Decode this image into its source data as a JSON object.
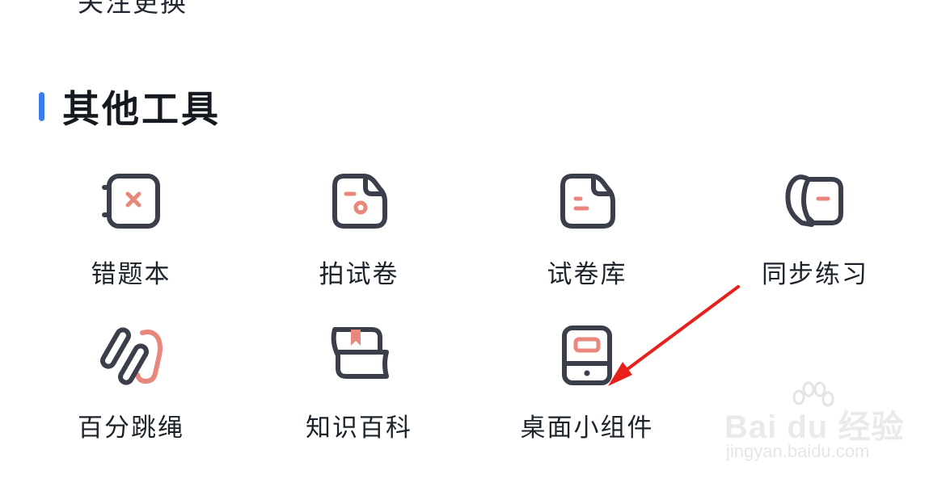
{
  "previous_section": {
    "label": "关注更换"
  },
  "section": {
    "title": "其他工具",
    "accent_color": "#3b7cf0"
  },
  "tools": [
    {
      "label": "错题本",
      "icon": "wrong-question-book-icon"
    },
    {
      "label": "拍试卷",
      "icon": "photo-test-paper-icon"
    },
    {
      "label": "试卷库",
      "icon": "test-paper-library-icon"
    },
    {
      "label": "同步练习",
      "icon": "sync-practice-icon"
    },
    {
      "label": "百分跳绳",
      "icon": "jump-rope-icon"
    },
    {
      "label": "知识百科",
      "icon": "knowledge-encyclopedia-icon"
    },
    {
      "label": "桌面小组件",
      "icon": "desktop-widget-icon"
    }
  ],
  "colors": {
    "icon_stroke": "#3a3f4b",
    "icon_accent": "#e8877c",
    "annotation_arrow": "#e8201a"
  },
  "watermark": {
    "brand": "Bai du 经验",
    "url": "jingyan.baidu.com"
  }
}
